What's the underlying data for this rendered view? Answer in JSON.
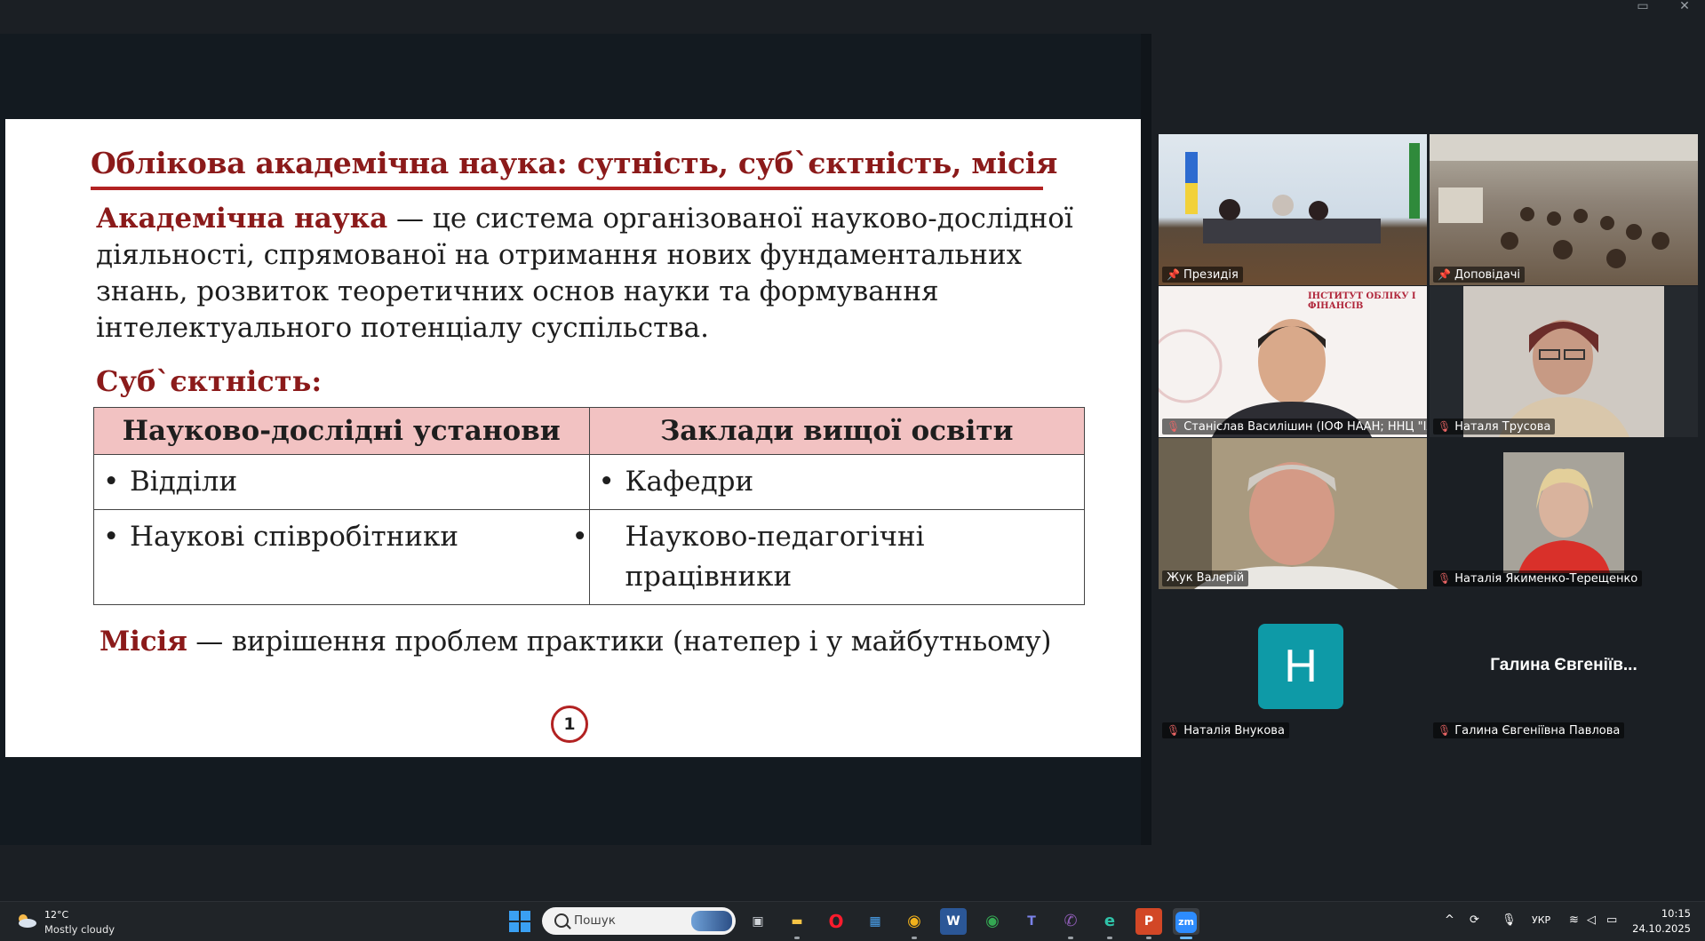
{
  "window": {
    "minimize_glyph": "▭",
    "close_glyph": "✕"
  },
  "slide": {
    "title": "Облікова академічна наука: сутність, суб`єктність, місія",
    "definition_term": "Академічна наука",
    "definition_text": " — це система організованої науково-дослідної діяльності, спрямованої на отримання нових фундаментальних знань, розвиток теоретичних основ науки та формування інтелектуального потенціалу суспільства.",
    "subjectness_heading": "Суб`єктність:",
    "table": {
      "headers": [
        "Науково-дослідні установи",
        "Заклади вищої освіти"
      ],
      "rows": [
        [
          "Відділи",
          "Кафедри"
        ],
        [
          "Наукові співробітники",
          "Науково-педагогічні працівники"
        ]
      ],
      "bullet": "•"
    },
    "mission_term": "Місія",
    "mission_text": " — вирішення проблем практики (натепер і у майбутньому)",
    "page_number": "1"
  },
  "participants": [
    {
      "name": "Президія",
      "icon": "pin-icon"
    },
    {
      "name": "Доповідачі",
      "icon": "pin-icon"
    },
    {
      "name": "Станіслав Василішин (ІОФ НААН; ННЦ \"ІАЕ\")",
      "icon": "mic-muted-icon",
      "logo_text": "ІНСТИТУТ ОБЛІКУ І ФІНАНСІВ"
    },
    {
      "name": "Наталя Трусова",
      "icon": "mic-muted-icon"
    },
    {
      "name": "Жук Валерій",
      "icon": "none",
      "active_speaker": true
    },
    {
      "name": "Наталія Якименко-Терещенко",
      "icon": "mic-muted-icon"
    },
    {
      "name": "Наталія Внукова",
      "icon": "mic-muted-icon",
      "avatar_letter": "Н",
      "avatar_color": "#0e9aa7"
    },
    {
      "name": "Галина Євгеніївна Павлова",
      "icon": "mic-muted-icon",
      "display_text": "Галина Євгеніїв..."
    }
  ],
  "taskbar": {
    "weather": {
      "temp": "12°C",
      "desc": "Mostly cloudy"
    },
    "search_placeholder": "Пошук",
    "apps": [
      {
        "name": "task-view",
        "glyph": "▣"
      },
      {
        "name": "file-explorer",
        "glyph": "▬"
      },
      {
        "name": "opera",
        "glyph": "O"
      },
      {
        "name": "microsoft-store",
        "glyph": "▦"
      },
      {
        "name": "chrome",
        "glyph": "◉"
      },
      {
        "name": "word",
        "glyph": "W"
      },
      {
        "name": "chrome-2",
        "glyph": "◉"
      },
      {
        "name": "teams",
        "glyph": "T"
      },
      {
        "name": "viber",
        "glyph": "✆"
      },
      {
        "name": "edge",
        "glyph": "e"
      },
      {
        "name": "powerpoint",
        "glyph": "P"
      },
      {
        "name": "zoom",
        "glyph": "zm"
      }
    ],
    "tray": {
      "chevron": "^",
      "language": "УКР"
    },
    "clock": {
      "time": "10:15",
      "date": "24.10.2025"
    }
  }
}
